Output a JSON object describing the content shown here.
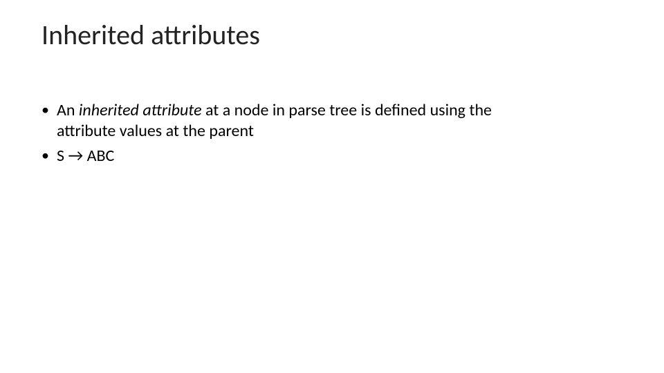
{
  "title": "Inherited attributes",
  "bullets": [
    {
      "prefix": "An ",
      "emphasis": "inherited attribute",
      "rest_line1": " at a node in parse tree is defined using the",
      "rest_line2": "attribute values at the parent"
    },
    {
      "text": "S → ABC"
    }
  ]
}
